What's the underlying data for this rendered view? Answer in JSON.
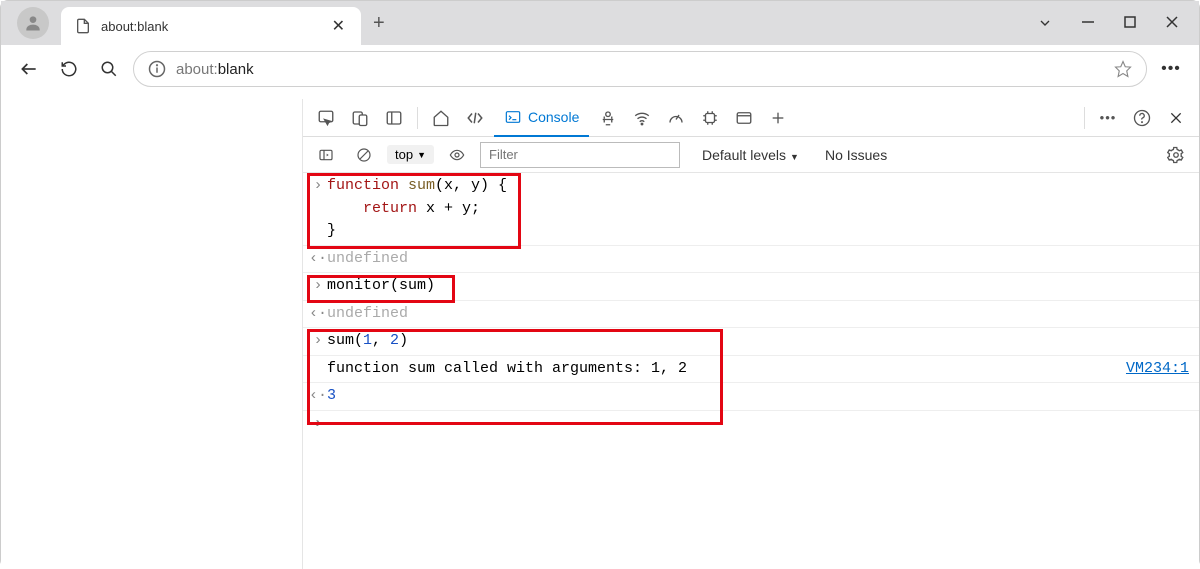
{
  "titlebar": {
    "tab_title": "about:blank"
  },
  "toolbar": {
    "url_scheme": "about:",
    "url_rest": "blank"
  },
  "devtools": {
    "tab_label": "Console"
  },
  "subbar": {
    "context": "top",
    "filter_placeholder": "Filter",
    "levels": "Default levels",
    "issues": "No Issues"
  },
  "console": {
    "entry1_line1_kw": "function",
    "entry1_line1_fn": " sum",
    "entry1_line1_rest": "(x, y) {",
    "entry1_line2_kw": "return",
    "entry1_line2_rest": " x + y;",
    "entry1_line3": "}",
    "undef1": "undefined",
    "entry2": "monitor(sum)",
    "undef2": "undefined",
    "entry3_pre": "sum(",
    "entry3_n1": "1",
    "entry3_mid": ", ",
    "entry3_n2": "2",
    "entry3_post": ")",
    "log_text": "function sum called with arguments: 1, 2",
    "log_source": "VM234:1",
    "result": "3"
  }
}
